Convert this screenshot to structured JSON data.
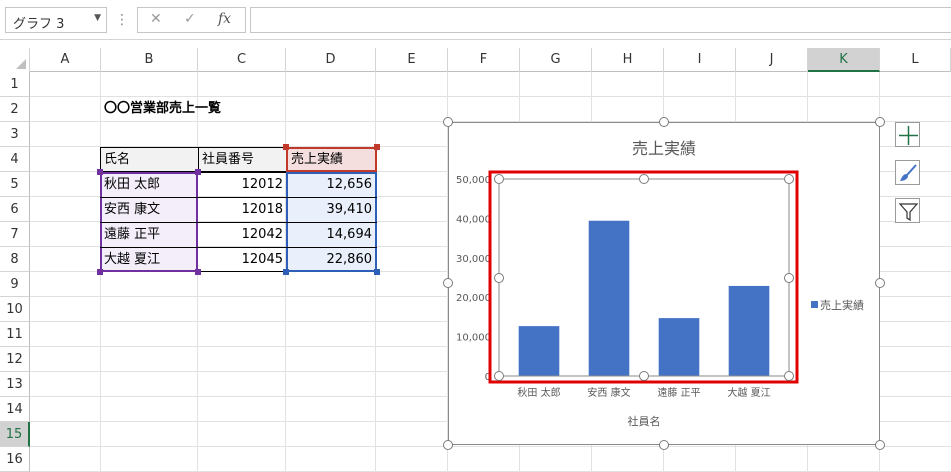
{
  "namebox": {
    "value": "グラフ 3"
  },
  "formula": {
    "cancel": "✕",
    "enter": "✓",
    "fx": "fx",
    "separator": "⋮",
    "value": ""
  },
  "columns": [
    "A",
    "B",
    "C",
    "D",
    "E",
    "F",
    "G",
    "H",
    "I",
    "J",
    "K",
    "L"
  ],
  "rows": [
    "1",
    "2",
    "3",
    "4",
    "5",
    "6",
    "7",
    "8",
    "9",
    "10",
    "11",
    "12",
    "13",
    "14",
    "15",
    "16"
  ],
  "sheet": {
    "title": "〇〇営業部売上一覧",
    "headers": [
      "氏名",
      "社員番号",
      "売上実績"
    ],
    "records": [
      {
        "name": "秋田 太郎",
        "id": "12012",
        "sales": "12,656"
      },
      {
        "name": "安西 康文",
        "id": "12018",
        "sales": "39,410"
      },
      {
        "name": "遠藤 正平",
        "id": "12042",
        "sales": "14,694"
      },
      {
        "name": "大越 夏江",
        "id": "12045",
        "sales": "22,860"
      }
    ]
  },
  "chart_data": {
    "type": "bar",
    "title": "売上実績",
    "xlabel": "社員名",
    "ylabel": "",
    "categories": [
      "秋田 太郎",
      "安西 康文",
      "遠藤 正平",
      "大越 夏江"
    ],
    "series": [
      {
        "name": "売上実績",
        "values": [
          12656,
          39410,
          14694,
          22860
        ]
      }
    ],
    "ylim": [
      0,
      50000
    ],
    "yticks": [
      "0",
      "10,000",
      "20,000",
      "30,000",
      "40,000",
      "50,000"
    ],
    "grid": false,
    "legend": "right",
    "bar_color": "#4472c4",
    "plot_highlight_color": "#e00000"
  },
  "colors": {
    "accent": "#217346",
    "name_range": "#7030a0",
    "value_range": "#2e5fb8",
    "header_range": "#c0392b"
  },
  "chart_tools": [
    "chart-elements-icon",
    "chart-styles-icon",
    "chart-filters-icon"
  ]
}
